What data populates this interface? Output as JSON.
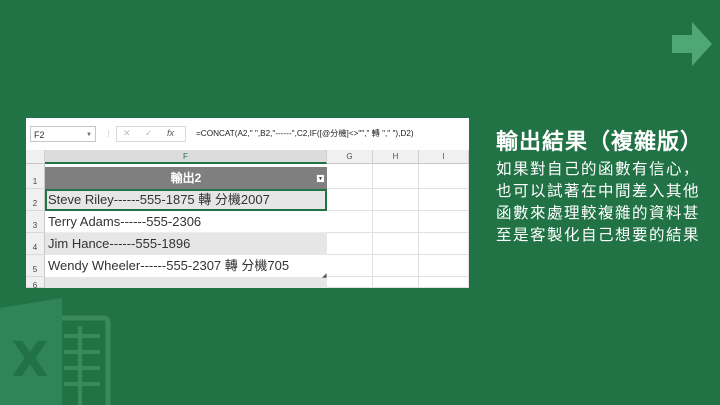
{
  "slide": {
    "title": "輸出結果（複雜版）",
    "description": "如果對自己的函數有信心，也可以試著在中間差入其他函數來處理較複雜的資料甚至是客製化自己想要的結果",
    "background_color": "#217346",
    "excel_logo_icon": "excel-logo-icon",
    "arrow_icon": "arrow-right-icon"
  },
  "excel": {
    "name_box": "F2",
    "formula": "=CONCAT(A2,\" \",B2,\"------\",C2,IF([@分機]<>\"\",\" 轉 \",\" \"),D2)",
    "columns": [
      "F",
      "G",
      "H",
      "I"
    ],
    "rows": [
      "1",
      "2",
      "3",
      "4",
      "5",
      "6"
    ],
    "header_cell": "輸出2",
    "cells": [
      "Steve Riley------555-1875 轉 分機2007",
      "Terry Adams------555-2306",
      "Jim Hance------555-1896",
      "Wendy Wheeler------555-2307 轉 分機705"
    ]
  }
}
